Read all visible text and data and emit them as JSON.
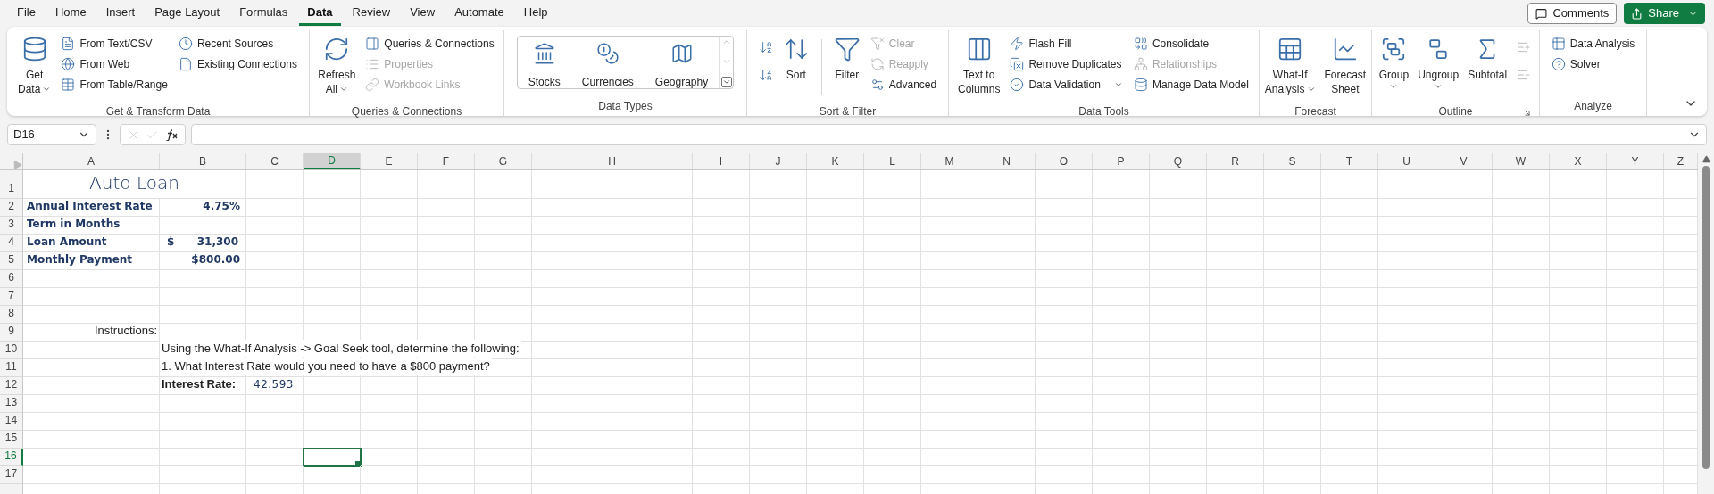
{
  "menu_tabs": [
    {
      "label": "File",
      "selected": false
    },
    {
      "label": "Home",
      "selected": false
    },
    {
      "label": "Insert",
      "selected": false
    },
    {
      "label": "Page Layout",
      "selected": false
    },
    {
      "label": "Formulas",
      "selected": false
    },
    {
      "label": "Data",
      "selected": true
    },
    {
      "label": "Review",
      "selected": false
    },
    {
      "label": "View",
      "selected": false
    },
    {
      "label": "Automate",
      "selected": false
    },
    {
      "label": "Help",
      "selected": false
    }
  ],
  "comments_button": "Comments",
  "share_button": "Share",
  "ribbon": [
    {
      "label": "Get & Transform Data",
      "items": [
        {
          "kind": "large",
          "lines": [
            "Get",
            "Data"
          ],
          "dropdown": true,
          "disabled": false
        },
        {
          "kind": "small",
          "label": "From Text/CSV",
          "disabled": false
        },
        {
          "kind": "small",
          "label": "From Web",
          "disabled": false
        },
        {
          "kind": "small",
          "label": "From Table/Range",
          "disabled": false
        },
        {
          "kind": "small",
          "label": "Recent Sources",
          "disabled": false
        },
        {
          "kind": "small",
          "label": "Existing Connections",
          "disabled": false
        }
      ]
    },
    {
      "label": "Queries & Connections",
      "items": [
        {
          "kind": "large",
          "lines": [
            "Refresh",
            "All"
          ],
          "dropdown": true,
          "disabled": false
        },
        {
          "kind": "small",
          "label": "Queries & Connections",
          "disabled": false
        },
        {
          "kind": "small",
          "label": "Properties",
          "disabled": true
        },
        {
          "kind": "small",
          "label": "Workbook Links",
          "disabled": true
        }
      ]
    },
    {
      "label": "Data Types",
      "items": [
        {
          "kind": "gallery",
          "lines": [
            "Stocks"
          ],
          "disabled": false
        },
        {
          "kind": "gallery",
          "lines": [
            "Currencies"
          ],
          "disabled": false
        },
        {
          "kind": "gallery",
          "lines": [
            "Geography"
          ],
          "disabled": false
        }
      ]
    },
    {
      "label": "Sort & Filter",
      "items": [
        {
          "kind": "icon",
          "disabled": false
        },
        {
          "kind": "icon",
          "disabled": false
        },
        {
          "kind": "large",
          "lines": [
            "Sort"
          ],
          "disabled": false
        },
        {
          "kind": "large",
          "lines": [
            "Filter"
          ],
          "disabled": false
        },
        {
          "kind": "small",
          "label": "Clear",
          "disabled": true
        },
        {
          "kind": "small",
          "label": "Reapply",
          "disabled": true
        },
        {
          "kind": "small",
          "label": "Advanced",
          "disabled": false
        }
      ]
    },
    {
      "label": "Data Tools",
      "items": [
        {
          "kind": "large",
          "lines": [
            "Text to",
            "Columns"
          ],
          "disabled": false
        },
        {
          "kind": "small",
          "label": "Flash Fill",
          "disabled": false
        },
        {
          "kind": "small",
          "label": "Remove Duplicates",
          "disabled": false
        },
        {
          "kind": "small",
          "label": "Data Validation",
          "dropdown": true,
          "disabled": false
        },
        {
          "kind": "small",
          "label": "Consolidate",
          "disabled": false
        },
        {
          "kind": "small",
          "label": "Relationships",
          "disabled": true
        },
        {
          "kind": "small",
          "label": "Manage Data Model",
          "disabled": false
        }
      ]
    },
    {
      "label": "Forecast",
      "items": [
        {
          "kind": "large",
          "lines": [
            "What-If",
            "Analysis"
          ],
          "dropdown": true,
          "disabled": false
        },
        {
          "kind": "large",
          "lines": [
            "Forecast",
            "Sheet"
          ],
          "disabled": false
        }
      ]
    },
    {
      "label": "Outline",
      "items": [
        {
          "kind": "large",
          "lines": [
            "Group"
          ],
          "dropdown": true,
          "disabled": false
        },
        {
          "kind": "large",
          "lines": [
            "Ungroup"
          ],
          "dropdown": true,
          "disabled": false
        },
        {
          "kind": "large",
          "lines": [
            "Subtotal"
          ],
          "disabled": false
        },
        {
          "kind": "icon",
          "disabled": true
        },
        {
          "kind": "icon",
          "disabled": true
        }
      ]
    },
    {
      "label": "Analyze",
      "items": [
        {
          "kind": "small",
          "label": "Data Analysis",
          "disabled": false
        },
        {
          "kind": "small",
          "label": "Solver",
          "disabled": false
        }
      ]
    }
  ],
  "name_box": "D16",
  "columns": [
    {
      "label": "A",
      "selected": false
    },
    {
      "label": "B",
      "selected": false
    },
    {
      "label": "C",
      "selected": false
    },
    {
      "label": "D",
      "selected": true
    },
    {
      "label": "E",
      "selected": false
    },
    {
      "label": "F",
      "selected": false
    },
    {
      "label": "G",
      "selected": false
    },
    {
      "label": "H",
      "selected": false
    },
    {
      "label": "I",
      "selected": false
    },
    {
      "label": "J",
      "selected": false
    },
    {
      "label": "K",
      "selected": false
    },
    {
      "label": "L",
      "selected": false
    },
    {
      "label": "M",
      "selected": false
    },
    {
      "label": "N",
      "selected": false
    },
    {
      "label": "O",
      "selected": false
    },
    {
      "label": "P",
      "selected": false
    },
    {
      "label": "Q",
      "selected": false
    },
    {
      "label": "R",
      "selected": false
    },
    {
      "label": "S",
      "selected": false
    },
    {
      "label": "T",
      "selected": false
    },
    {
      "label": "U",
      "selected": false
    },
    {
      "label": "V",
      "selected": false
    },
    {
      "label": "W",
      "selected": false
    },
    {
      "label": "X",
      "selected": false
    },
    {
      "label": "Y",
      "selected": false
    },
    {
      "label": "Z",
      "selected": false
    }
  ],
  "rows": [
    {
      "header": "1",
      "selected": false,
      "a": {
        "text": "Auto Loan",
        "kind": "title"
      }
    },
    {
      "header": "2",
      "selected": false,
      "a": {
        "text": "Annual Interest Rate",
        "kind": "label"
      },
      "b": {
        "text": "4.75%",
        "kind": "value"
      }
    },
    {
      "header": "3",
      "selected": false,
      "a": {
        "text": "Term in Months",
        "kind": "label"
      }
    },
    {
      "header": "4",
      "selected": false,
      "a": {
        "text": "Loan Amount",
        "kind": "label"
      },
      "b": {
        "currency": "$",
        "text": "31,300",
        "kind": "accounting"
      }
    },
    {
      "header": "5",
      "selected": false,
      "a": {
        "text": "Monthly Payment",
        "kind": "label"
      },
      "b": {
        "text": "$800.00",
        "kind": "value"
      }
    },
    {
      "header": "6",
      "selected": false
    },
    {
      "header": "7",
      "selected": false
    },
    {
      "header": "8",
      "selected": false
    },
    {
      "header": "9",
      "selected": false,
      "a": {
        "text": "Instructions:",
        "kind": "note"
      }
    },
    {
      "header": "10",
      "selected": false,
      "b": {
        "text": "Using the What-If Analysis -> Goal Seek tool, determine the following:",
        "kind": "overflow"
      }
    },
    {
      "header": "11",
      "selected": false,
      "b": {
        "text": "1. What Interest Rate would you need to have a $800 payment?",
        "kind": "overflow"
      }
    },
    {
      "header": "12",
      "selected": false,
      "b": {
        "text": "Interest Rate:",
        "kind": "bold"
      },
      "c": {
        "text": "42.593",
        "kind": "result"
      }
    },
    {
      "header": "13",
      "selected": false
    },
    {
      "header": "14",
      "selected": false
    },
    {
      "header": "15",
      "selected": false
    },
    {
      "header": "16",
      "selected": true
    },
    {
      "header": "17",
      "selected": false
    }
  ]
}
